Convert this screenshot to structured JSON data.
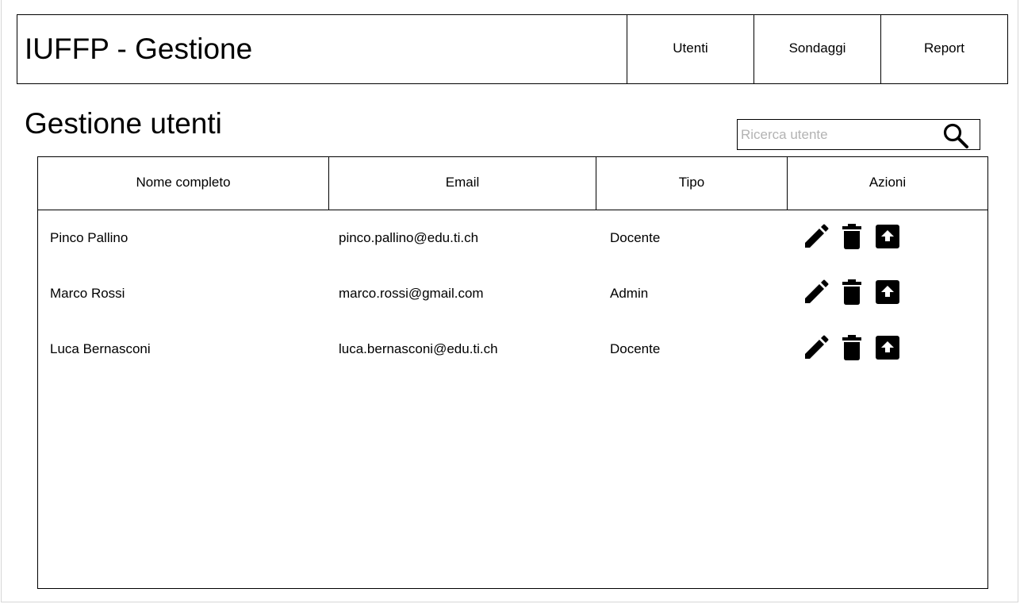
{
  "header": {
    "title": "IUFFP - Gestione",
    "nav": [
      {
        "label": "Utenti"
      },
      {
        "label": "Sondaggi"
      },
      {
        "label": "Report"
      }
    ]
  },
  "page": {
    "title": "Gestione utenti"
  },
  "search": {
    "placeholder": "Ricerca utente",
    "value": "",
    "icon": "search-icon"
  },
  "table": {
    "columns": [
      "Nome completo",
      "Email",
      "Tipo",
      "Azioni"
    ],
    "rows": [
      {
        "name": "Pinco Pallino",
        "email": "pinco.pallino@edu.ti.ch",
        "type": "Docente"
      },
      {
        "name": "Marco Rossi",
        "email": "marco.rossi@gmail.com",
        "type": "Admin"
      },
      {
        "name": "Luca Bernasconi",
        "email": "luca.bernasconi@edu.ti.ch",
        "type": "Docente"
      }
    ],
    "action_icons": [
      "edit-pencil-icon",
      "delete-trash-icon",
      "upload-arrow-icon"
    ]
  },
  "colors": {
    "border": "#000000",
    "placeholder": "#b3b3b3",
    "frame": "#d6d6d6"
  }
}
